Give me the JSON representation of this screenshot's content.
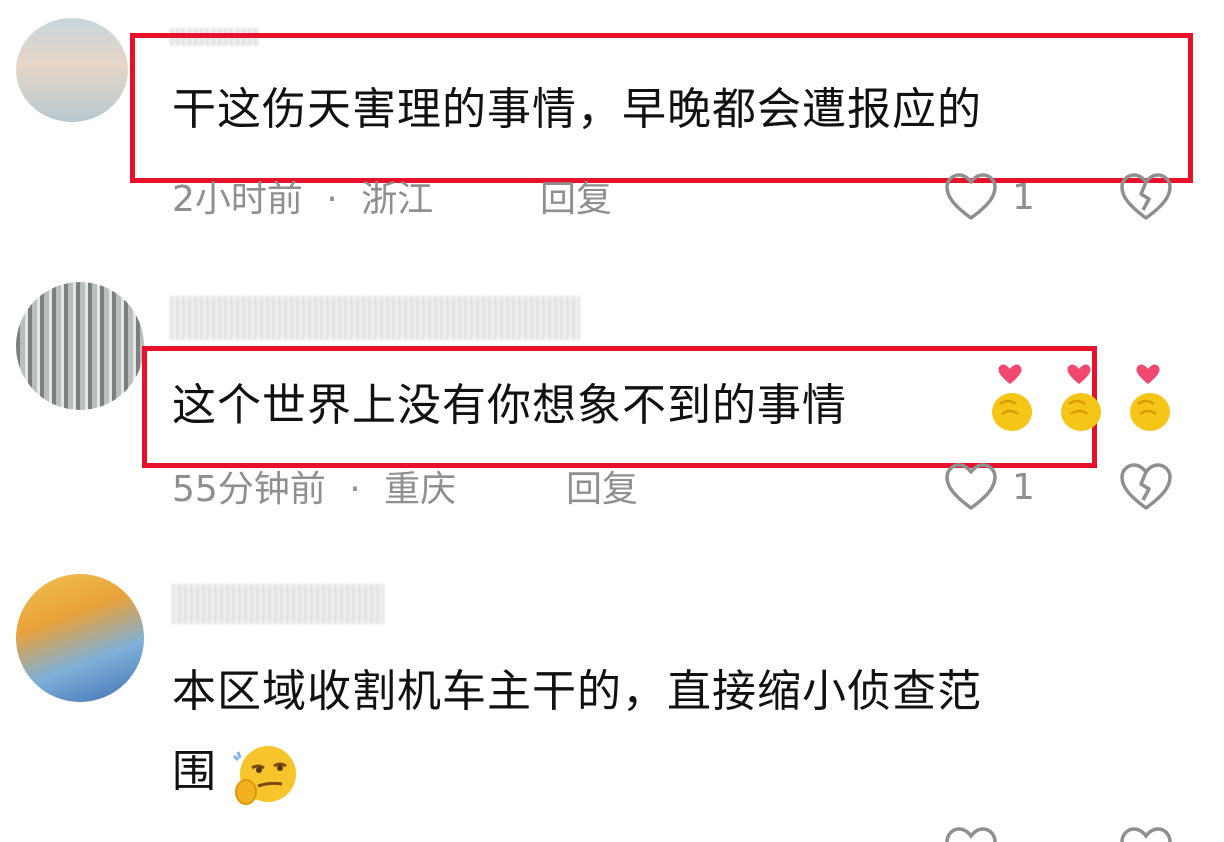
{
  "comments": [
    {
      "text": "干这伤天害理的事情，早晚都会遭报应的",
      "time": "2小时前",
      "location": "浙江",
      "reply_label": "回复",
      "like_count": "1"
    },
    {
      "text": "这个世界上没有你想象不到的事情",
      "time": "55分钟前",
      "location": "重庆",
      "reply_label": "回复",
      "like_count": "1",
      "emojis": [
        "finger-heart-emoji",
        "finger-heart-emoji",
        "finger-heart-emoji"
      ]
    },
    {
      "text_line1": "本区域收割机车主干的，直接缩小侦查范",
      "text_line2": "围",
      "emojis": [
        "smirk-thinking-emoji"
      ]
    }
  ],
  "separator": "·",
  "colors": {
    "highlight_box": "#e8102a",
    "meta_text": "#8f8f8f",
    "comment_text": "#111111"
  }
}
